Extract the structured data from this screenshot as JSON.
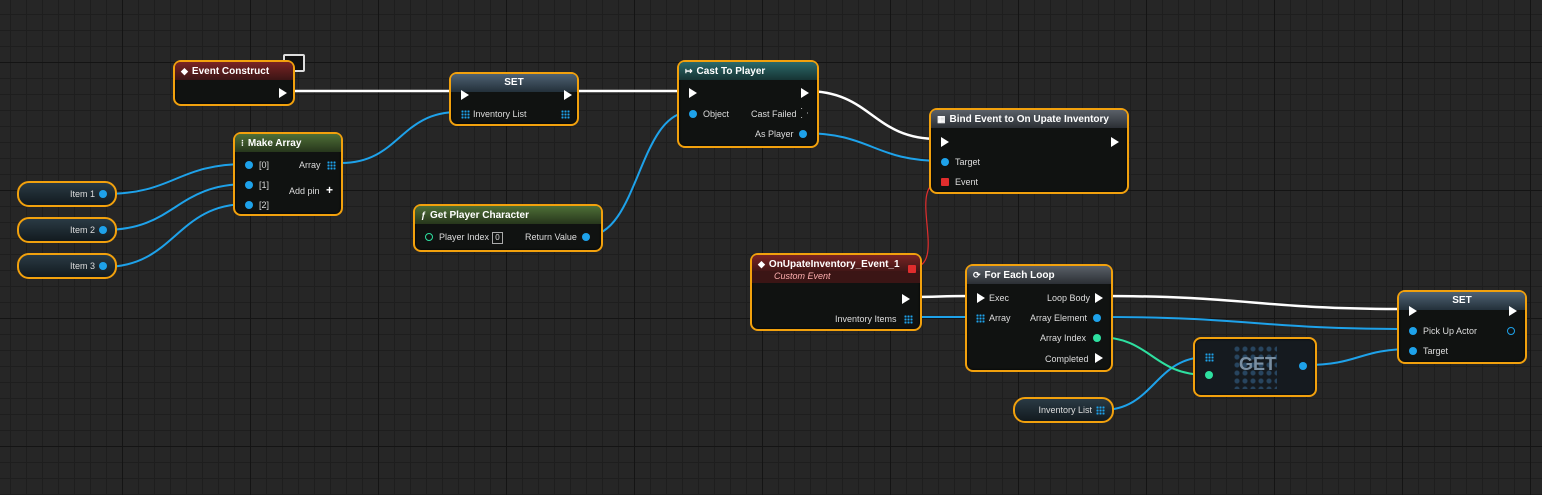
{
  "colors": {
    "wire_data": "#1ea2ea",
    "wire_int": "#2ee0a0",
    "wire_exec": "#ffffff",
    "wire_delegate": "#e02d2d",
    "selection": "#f2a10d"
  },
  "event_construct": {
    "title": "Event Construct",
    "icon": "diamond-event-icon"
  },
  "set_inventory": {
    "title": "SET",
    "pin": "Inventory List"
  },
  "make_array": {
    "title": "Make Array",
    "pins": [
      "[0]",
      "[1]",
      "[2]"
    ],
    "out": "Array",
    "add_pin": "Add pin"
  },
  "items": [
    "Item 1",
    "Item 2",
    "Item 3"
  ],
  "get_player": {
    "title": "Get Player Character",
    "index_label": "Player Index",
    "index_value": "0",
    "out": "Return Value"
  },
  "cast": {
    "title": "Cast To Player",
    "object": "Object",
    "failed": "Cast Failed",
    "as_player": "As Player"
  },
  "bind": {
    "title": "Bind Event to On Upate Inventory",
    "target": "Target",
    "event": "Event"
  },
  "custom_event": {
    "title": "OnUpateInventory_Event_1",
    "subtitle": "Custom Event",
    "out": "Inventory Items"
  },
  "foreach": {
    "title": "For Each Loop",
    "exec": "Exec",
    "array": "Array",
    "loop_body": "Loop Body",
    "element": "Array Element",
    "index": "Array Index",
    "completed": "Completed"
  },
  "get_node": {
    "label": "GET"
  },
  "inv_list_var": {
    "label": "Inventory List"
  },
  "set_pickup": {
    "title": "SET",
    "pickup": "Pick Up Actor",
    "target": "Target"
  }
}
